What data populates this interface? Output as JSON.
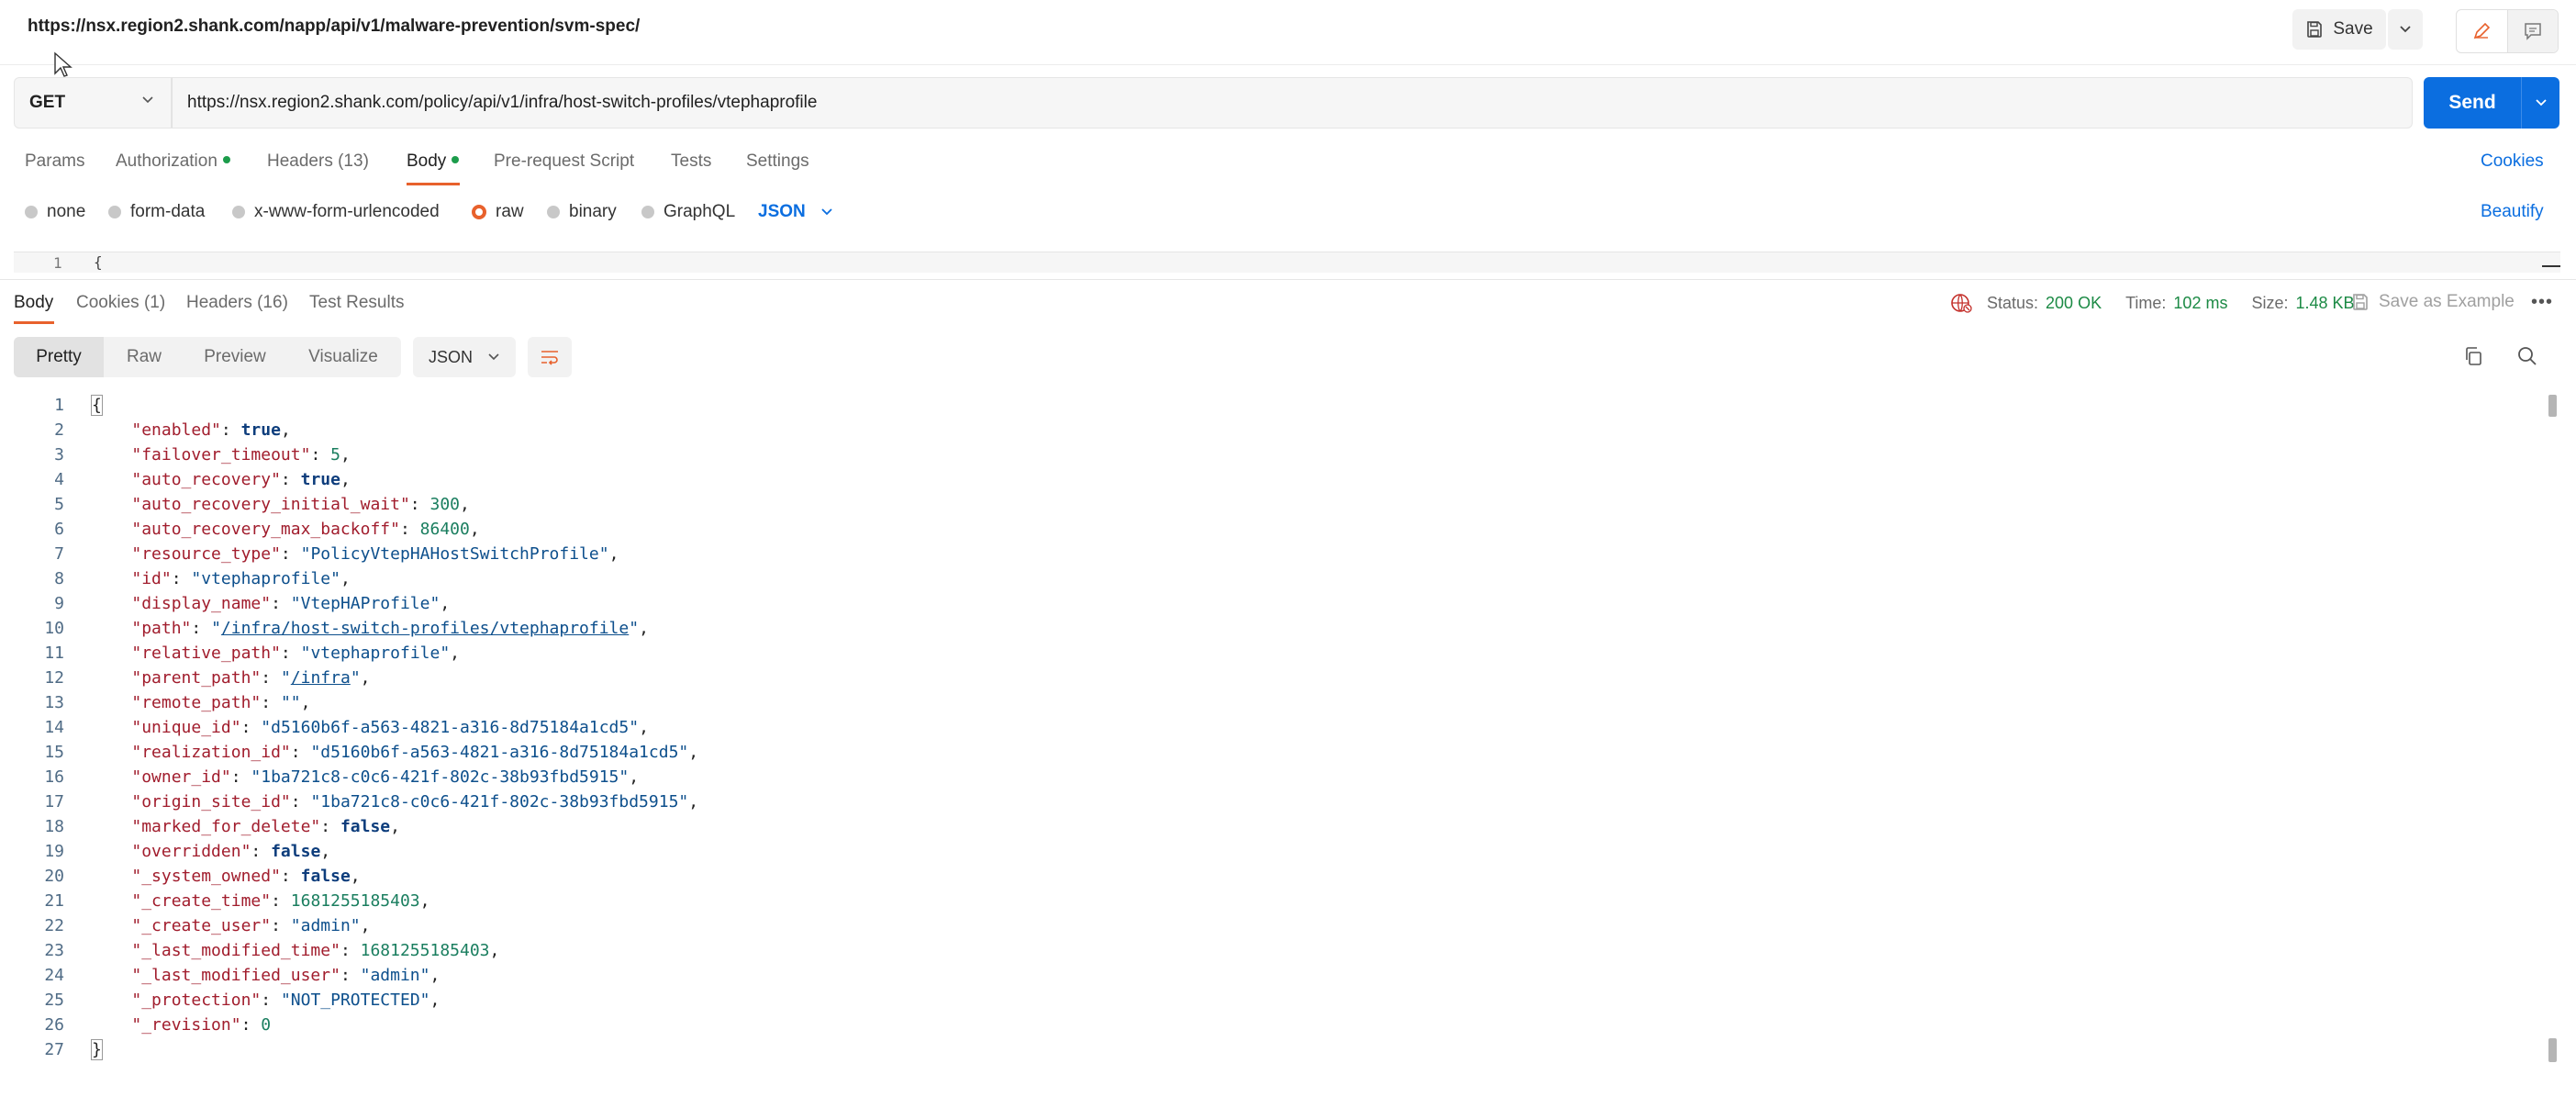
{
  "top": {
    "title": "https://nsx.region2.shank.com/napp/api/v1/malware-prevention/svm-spec/",
    "save_label": "Save"
  },
  "request": {
    "method": "GET",
    "url": "https://nsx.region2.shank.com/policy/api/v1/infra/host-switch-profiles/vtephaprofile",
    "send_label": "Send",
    "tabs": [
      {
        "label": "Params",
        "count": "",
        "dot": false
      },
      {
        "label": "Authorization",
        "count": "",
        "dot": true
      },
      {
        "label": "Headers",
        "count": "(13)",
        "dot": false
      },
      {
        "label": "Body",
        "count": "",
        "dot": true
      },
      {
        "label": "Pre-request Script",
        "count": "",
        "dot": false
      },
      {
        "label": "Tests",
        "count": "",
        "dot": false
      },
      {
        "label": "Settings",
        "count": "",
        "dot": false
      }
    ],
    "cookies_label": "Cookies",
    "body_types": [
      "none",
      "form-data",
      "x-www-form-urlencoded",
      "raw",
      "binary",
      "GraphQL"
    ],
    "selected_body_type": "raw",
    "body_format": "JSON",
    "beautify_label": "Beautify",
    "editor_line_number": "1",
    "editor_first_char": "{"
  },
  "response": {
    "tabs": [
      {
        "label": "Body",
        "count": ""
      },
      {
        "label": "Cookies",
        "count": "(1)"
      },
      {
        "label": "Headers",
        "count": "(16)"
      },
      {
        "label": "Test Results",
        "count": ""
      }
    ],
    "status_label": "Status:",
    "status_value": "200 OK",
    "time_label": "Time:",
    "time_value": "102 ms",
    "size_label": "Size:",
    "size_value": "1.48 KB",
    "save_example_label": "Save as Example",
    "views": [
      "Pretty",
      "Raw",
      "Preview",
      "Visualize"
    ],
    "format": "JSON"
  },
  "colors": {
    "accent": "#e8612c",
    "primary": "#0b6ee0",
    "success": "#1c8a45"
  },
  "code_lines": [
    [
      {
        "t": "{",
        "c": "p"
      }
    ],
    [
      {
        "t": "    ",
        "c": "p"
      },
      {
        "t": "\"enabled\"",
        "c": "k"
      },
      {
        "t": ": ",
        "c": "p"
      },
      {
        "t": "true",
        "c": "b"
      },
      {
        "t": ",",
        "c": "p"
      }
    ],
    [
      {
        "t": "    ",
        "c": "p"
      },
      {
        "t": "\"failover_timeout\"",
        "c": "k"
      },
      {
        "t": ": ",
        "c": "p"
      },
      {
        "t": "5",
        "c": "n"
      },
      {
        "t": ",",
        "c": "p"
      }
    ],
    [
      {
        "t": "    ",
        "c": "p"
      },
      {
        "t": "\"auto_recovery\"",
        "c": "k"
      },
      {
        "t": ": ",
        "c": "p"
      },
      {
        "t": "true",
        "c": "b"
      },
      {
        "t": ",",
        "c": "p"
      }
    ],
    [
      {
        "t": "    ",
        "c": "p"
      },
      {
        "t": "\"auto_recovery_initial_wait\"",
        "c": "k"
      },
      {
        "t": ": ",
        "c": "p"
      },
      {
        "t": "300",
        "c": "n"
      },
      {
        "t": ",",
        "c": "p"
      }
    ],
    [
      {
        "t": "    ",
        "c": "p"
      },
      {
        "t": "\"auto_recovery_max_backoff\"",
        "c": "k"
      },
      {
        "t": ": ",
        "c": "p"
      },
      {
        "t": "86400",
        "c": "n"
      },
      {
        "t": ",",
        "c": "p"
      }
    ],
    [
      {
        "t": "    ",
        "c": "p"
      },
      {
        "t": "\"resource_type\"",
        "c": "k"
      },
      {
        "t": ": ",
        "c": "p"
      },
      {
        "t": "\"PolicyVtepHAHostSwitchProfile\"",
        "c": "s"
      },
      {
        "t": ",",
        "c": "p"
      }
    ],
    [
      {
        "t": "    ",
        "c": "p"
      },
      {
        "t": "\"id\"",
        "c": "k"
      },
      {
        "t": ": ",
        "c": "p"
      },
      {
        "t": "\"vtephaprofile\"",
        "c": "s"
      },
      {
        "t": ",",
        "c": "p"
      }
    ],
    [
      {
        "t": "    ",
        "c": "p"
      },
      {
        "t": "\"display_name\"",
        "c": "k"
      },
      {
        "t": ": ",
        "c": "p"
      },
      {
        "t": "\"VtepHAProfile\"",
        "c": "s"
      },
      {
        "t": ",",
        "c": "p"
      }
    ],
    [
      {
        "t": "    ",
        "c": "p"
      },
      {
        "t": "\"path\"",
        "c": "k"
      },
      {
        "t": ": ",
        "c": "p"
      },
      {
        "t": "\"",
        "c": "s"
      },
      {
        "t": "/infra/host-switch-profiles/vtephaprofile",
        "c": "u"
      },
      {
        "t": "\"",
        "c": "s"
      },
      {
        "t": ",",
        "c": "p"
      }
    ],
    [
      {
        "t": "    ",
        "c": "p"
      },
      {
        "t": "\"relative_path\"",
        "c": "k"
      },
      {
        "t": ": ",
        "c": "p"
      },
      {
        "t": "\"vtephaprofile\"",
        "c": "s"
      },
      {
        "t": ",",
        "c": "p"
      }
    ],
    [
      {
        "t": "    ",
        "c": "p"
      },
      {
        "t": "\"parent_path\"",
        "c": "k"
      },
      {
        "t": ": ",
        "c": "p"
      },
      {
        "t": "\"",
        "c": "s"
      },
      {
        "t": "/infra",
        "c": "u"
      },
      {
        "t": "\"",
        "c": "s"
      },
      {
        "t": ",",
        "c": "p"
      }
    ],
    [
      {
        "t": "    ",
        "c": "p"
      },
      {
        "t": "\"remote_path\"",
        "c": "k"
      },
      {
        "t": ": ",
        "c": "p"
      },
      {
        "t": "\"\"",
        "c": "s"
      },
      {
        "t": ",",
        "c": "p"
      }
    ],
    [
      {
        "t": "    ",
        "c": "p"
      },
      {
        "t": "\"unique_id\"",
        "c": "k"
      },
      {
        "t": ": ",
        "c": "p"
      },
      {
        "t": "\"d5160b6f-a563-4821-a316-8d75184a1cd5\"",
        "c": "s"
      },
      {
        "t": ",",
        "c": "p"
      }
    ],
    [
      {
        "t": "    ",
        "c": "p"
      },
      {
        "t": "\"realization_id\"",
        "c": "k"
      },
      {
        "t": ": ",
        "c": "p"
      },
      {
        "t": "\"d5160b6f-a563-4821-a316-8d75184a1cd5\"",
        "c": "s"
      },
      {
        "t": ",",
        "c": "p"
      }
    ],
    [
      {
        "t": "    ",
        "c": "p"
      },
      {
        "t": "\"owner_id\"",
        "c": "k"
      },
      {
        "t": ": ",
        "c": "p"
      },
      {
        "t": "\"1ba721c8-c0c6-421f-802c-38b93fbd5915\"",
        "c": "s"
      },
      {
        "t": ",",
        "c": "p"
      }
    ],
    [
      {
        "t": "    ",
        "c": "p"
      },
      {
        "t": "\"origin_site_id\"",
        "c": "k"
      },
      {
        "t": ": ",
        "c": "p"
      },
      {
        "t": "\"1ba721c8-c0c6-421f-802c-38b93fbd5915\"",
        "c": "s"
      },
      {
        "t": ",",
        "c": "p"
      }
    ],
    [
      {
        "t": "    ",
        "c": "p"
      },
      {
        "t": "\"marked_for_delete\"",
        "c": "k"
      },
      {
        "t": ": ",
        "c": "p"
      },
      {
        "t": "false",
        "c": "b"
      },
      {
        "t": ",",
        "c": "p"
      }
    ],
    [
      {
        "t": "    ",
        "c": "p"
      },
      {
        "t": "\"overridden\"",
        "c": "k"
      },
      {
        "t": ": ",
        "c": "p"
      },
      {
        "t": "false",
        "c": "b"
      },
      {
        "t": ",",
        "c": "p"
      }
    ],
    [
      {
        "t": "    ",
        "c": "p"
      },
      {
        "t": "\"_system_owned\"",
        "c": "k"
      },
      {
        "t": ": ",
        "c": "p"
      },
      {
        "t": "false",
        "c": "b"
      },
      {
        "t": ",",
        "c": "p"
      }
    ],
    [
      {
        "t": "    ",
        "c": "p"
      },
      {
        "t": "\"_create_time\"",
        "c": "k"
      },
      {
        "t": ": ",
        "c": "p"
      },
      {
        "t": "1681255185403",
        "c": "n"
      },
      {
        "t": ",",
        "c": "p"
      }
    ],
    [
      {
        "t": "    ",
        "c": "p"
      },
      {
        "t": "\"_create_user\"",
        "c": "k"
      },
      {
        "t": ": ",
        "c": "p"
      },
      {
        "t": "\"admin\"",
        "c": "s"
      },
      {
        "t": ",",
        "c": "p"
      }
    ],
    [
      {
        "t": "    ",
        "c": "p"
      },
      {
        "t": "\"_last_modified_time\"",
        "c": "k"
      },
      {
        "t": ": ",
        "c": "p"
      },
      {
        "t": "1681255185403",
        "c": "n"
      },
      {
        "t": ",",
        "c": "p"
      }
    ],
    [
      {
        "t": "    ",
        "c": "p"
      },
      {
        "t": "\"_last_modified_user\"",
        "c": "k"
      },
      {
        "t": ": ",
        "c": "p"
      },
      {
        "t": "\"admin\"",
        "c": "s"
      },
      {
        "t": ",",
        "c": "p"
      }
    ],
    [
      {
        "t": "    ",
        "c": "p"
      },
      {
        "t": "\"_protection\"",
        "c": "k"
      },
      {
        "t": ": ",
        "c": "p"
      },
      {
        "t": "\"NOT_PROTECTED\"",
        "c": "s"
      },
      {
        "t": ",",
        "c": "p"
      }
    ],
    [
      {
        "t": "    ",
        "c": "p"
      },
      {
        "t": "\"_revision\"",
        "c": "k"
      },
      {
        "t": ": ",
        "c": "p"
      },
      {
        "t": "0",
        "c": "n"
      }
    ],
    [
      {
        "t": "}",
        "c": "p"
      }
    ]
  ]
}
